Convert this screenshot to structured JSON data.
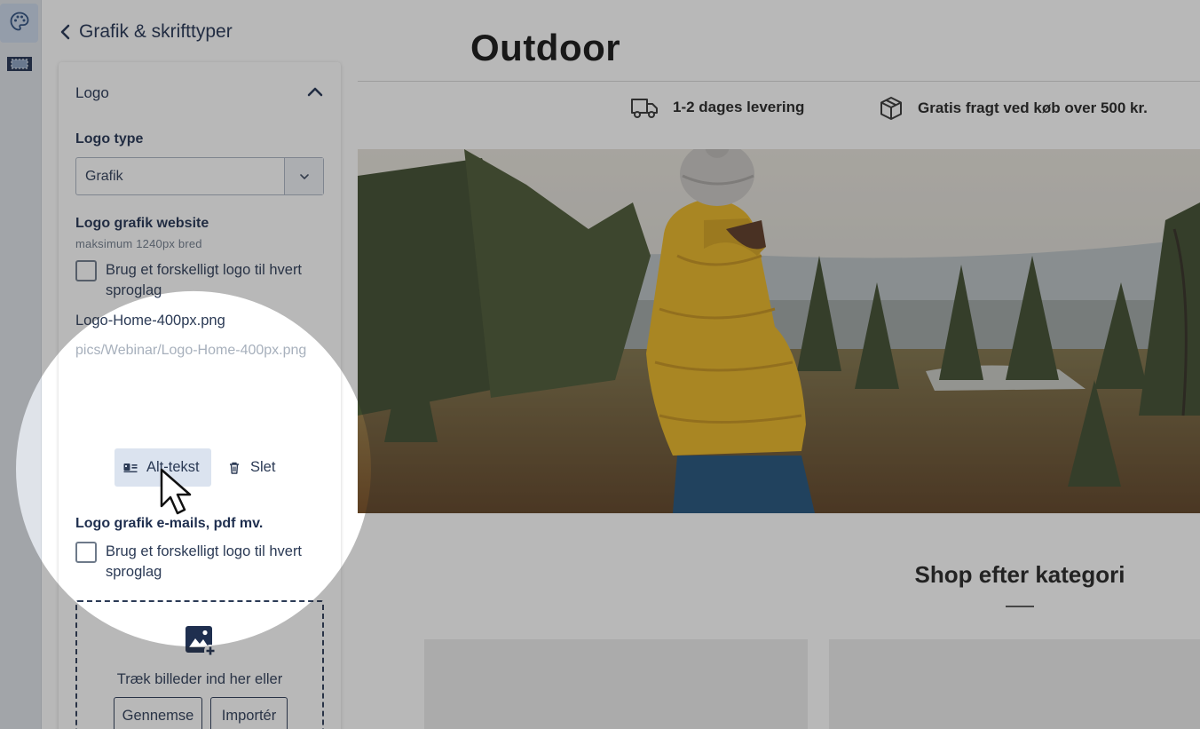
{
  "sidebar": {
    "title": "Grafik & skrifttyper",
    "section_title": "Logo",
    "logo_type_label": "Logo type",
    "logo_type_value": "Grafik",
    "website_label": "Logo grafik website",
    "website_hint": "maksimum 1240px bred",
    "per_language_label": "Brug et forskelligt logo til hvert sproglag",
    "file_name": "Logo-Home-400px.png",
    "file_path": "pics/Webinar/Logo-Home-400px.png",
    "alt_text_button": "Alt-tekst",
    "delete_button": "Slet",
    "emails_label": "Logo grafik e-mails, pdf mv.",
    "per_language_label_2": "Brug et forskelligt logo til hvert sproglag",
    "dropzone_text": "Træk billeder ind her eller",
    "browse_button": "Gennemse",
    "import_button": "Importér"
  },
  "preview": {
    "store_name": "Outdoor",
    "usp_delivery": "1-2 dages levering",
    "usp_shipping": "Gratis fragt ved køb over 500 kr.",
    "category_title": "Shop efter kategori"
  },
  "colors": {
    "navy": "#1f2f4f",
    "accent_bg": "#dbe3ef",
    "jacket": "#e9b521"
  },
  "icons": [
    "palette-icon",
    "layout-icon",
    "chevron-left-icon",
    "chevron-up-icon",
    "chevron-down-icon",
    "alt-text-icon",
    "trash-icon",
    "add-image-icon",
    "truck-icon",
    "box-icon",
    "cursor-icon"
  ]
}
